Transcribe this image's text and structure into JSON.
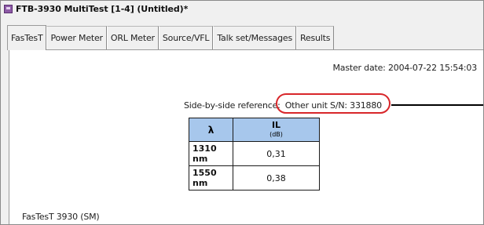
{
  "window": {
    "title": "FTB-3930 MultiTest [1-4] (Untitled)*",
    "app_icon": "app-icon"
  },
  "tabs": [
    {
      "label": "FasTesT",
      "active": true
    },
    {
      "label": "Power Meter",
      "active": false
    },
    {
      "label": "ORL Meter",
      "active": false
    },
    {
      "label": "Source/VFL",
      "active": false
    },
    {
      "label": "Talk set/Messages",
      "active": false
    },
    {
      "label": "Results",
      "active": false
    }
  ],
  "report": {
    "master_date": "Master date: 2004-07-22 15:54:03",
    "reference_label": "Side-by-side reference:",
    "reference_value": "Other unit S/N: 331880",
    "table": {
      "col_wavelength": "λ",
      "col_loss": "IL",
      "col_loss_unit": "(dB)",
      "rows": [
        {
          "wavelength": "1310 nm",
          "loss": "0,31"
        },
        {
          "wavelength": "1550 nm",
          "loss": "0,38"
        }
      ]
    },
    "footer": "FasTesT 3930 (SM)"
  },
  "colors": {
    "highlight": "#d8262a",
    "table_header": "#a7c7ec"
  }
}
